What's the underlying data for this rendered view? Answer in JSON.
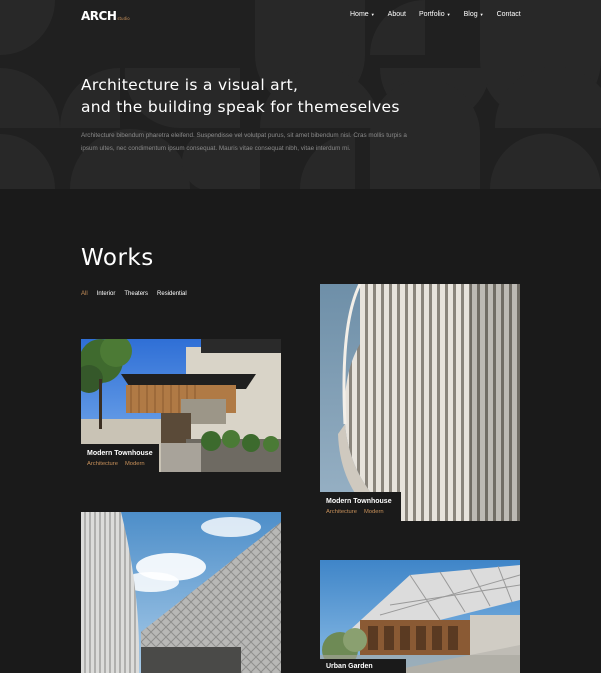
{
  "brand": {
    "logo": "ARCH",
    "logo_suffix": "studio"
  },
  "nav": {
    "items": [
      {
        "label": "Home",
        "dropdown": true
      },
      {
        "label": "About",
        "dropdown": false
      },
      {
        "label": "Portfolio",
        "dropdown": true
      },
      {
        "label": "Blog",
        "dropdown": true
      },
      {
        "label": "Contact",
        "dropdown": false
      }
    ]
  },
  "hero": {
    "title_line1": "Architecture is a visual art,",
    "title_line2": "and the building speak for themeselves",
    "description": "Architecture bibendum pharetra eleifend. Suspendisse vel volutpat purus, sit amet bibendum nisl. Cras mollis turpis a ipsum ultes, nec condimentum ipsum consequat. Mauris vitae consequat nibh, vitae interdum mi."
  },
  "works": {
    "title": "Works",
    "filters": [
      "All",
      "Interior",
      "Theaters",
      "Residential"
    ],
    "active_filter": "All",
    "cards": [
      {
        "title": "Modern Townhouse",
        "tags": [
          "Architecture",
          "Modern"
        ]
      },
      {
        "title": "Modern Townhouse",
        "tags": [
          "Architecture",
          "Modern"
        ]
      },
      {
        "title": "",
        "tags": []
      },
      {
        "title": "Urban Garden",
        "tags": []
      }
    ]
  },
  "colors": {
    "accent": "#c7905a",
    "background": "#1a1a1a",
    "hero_bg": "#202020"
  }
}
